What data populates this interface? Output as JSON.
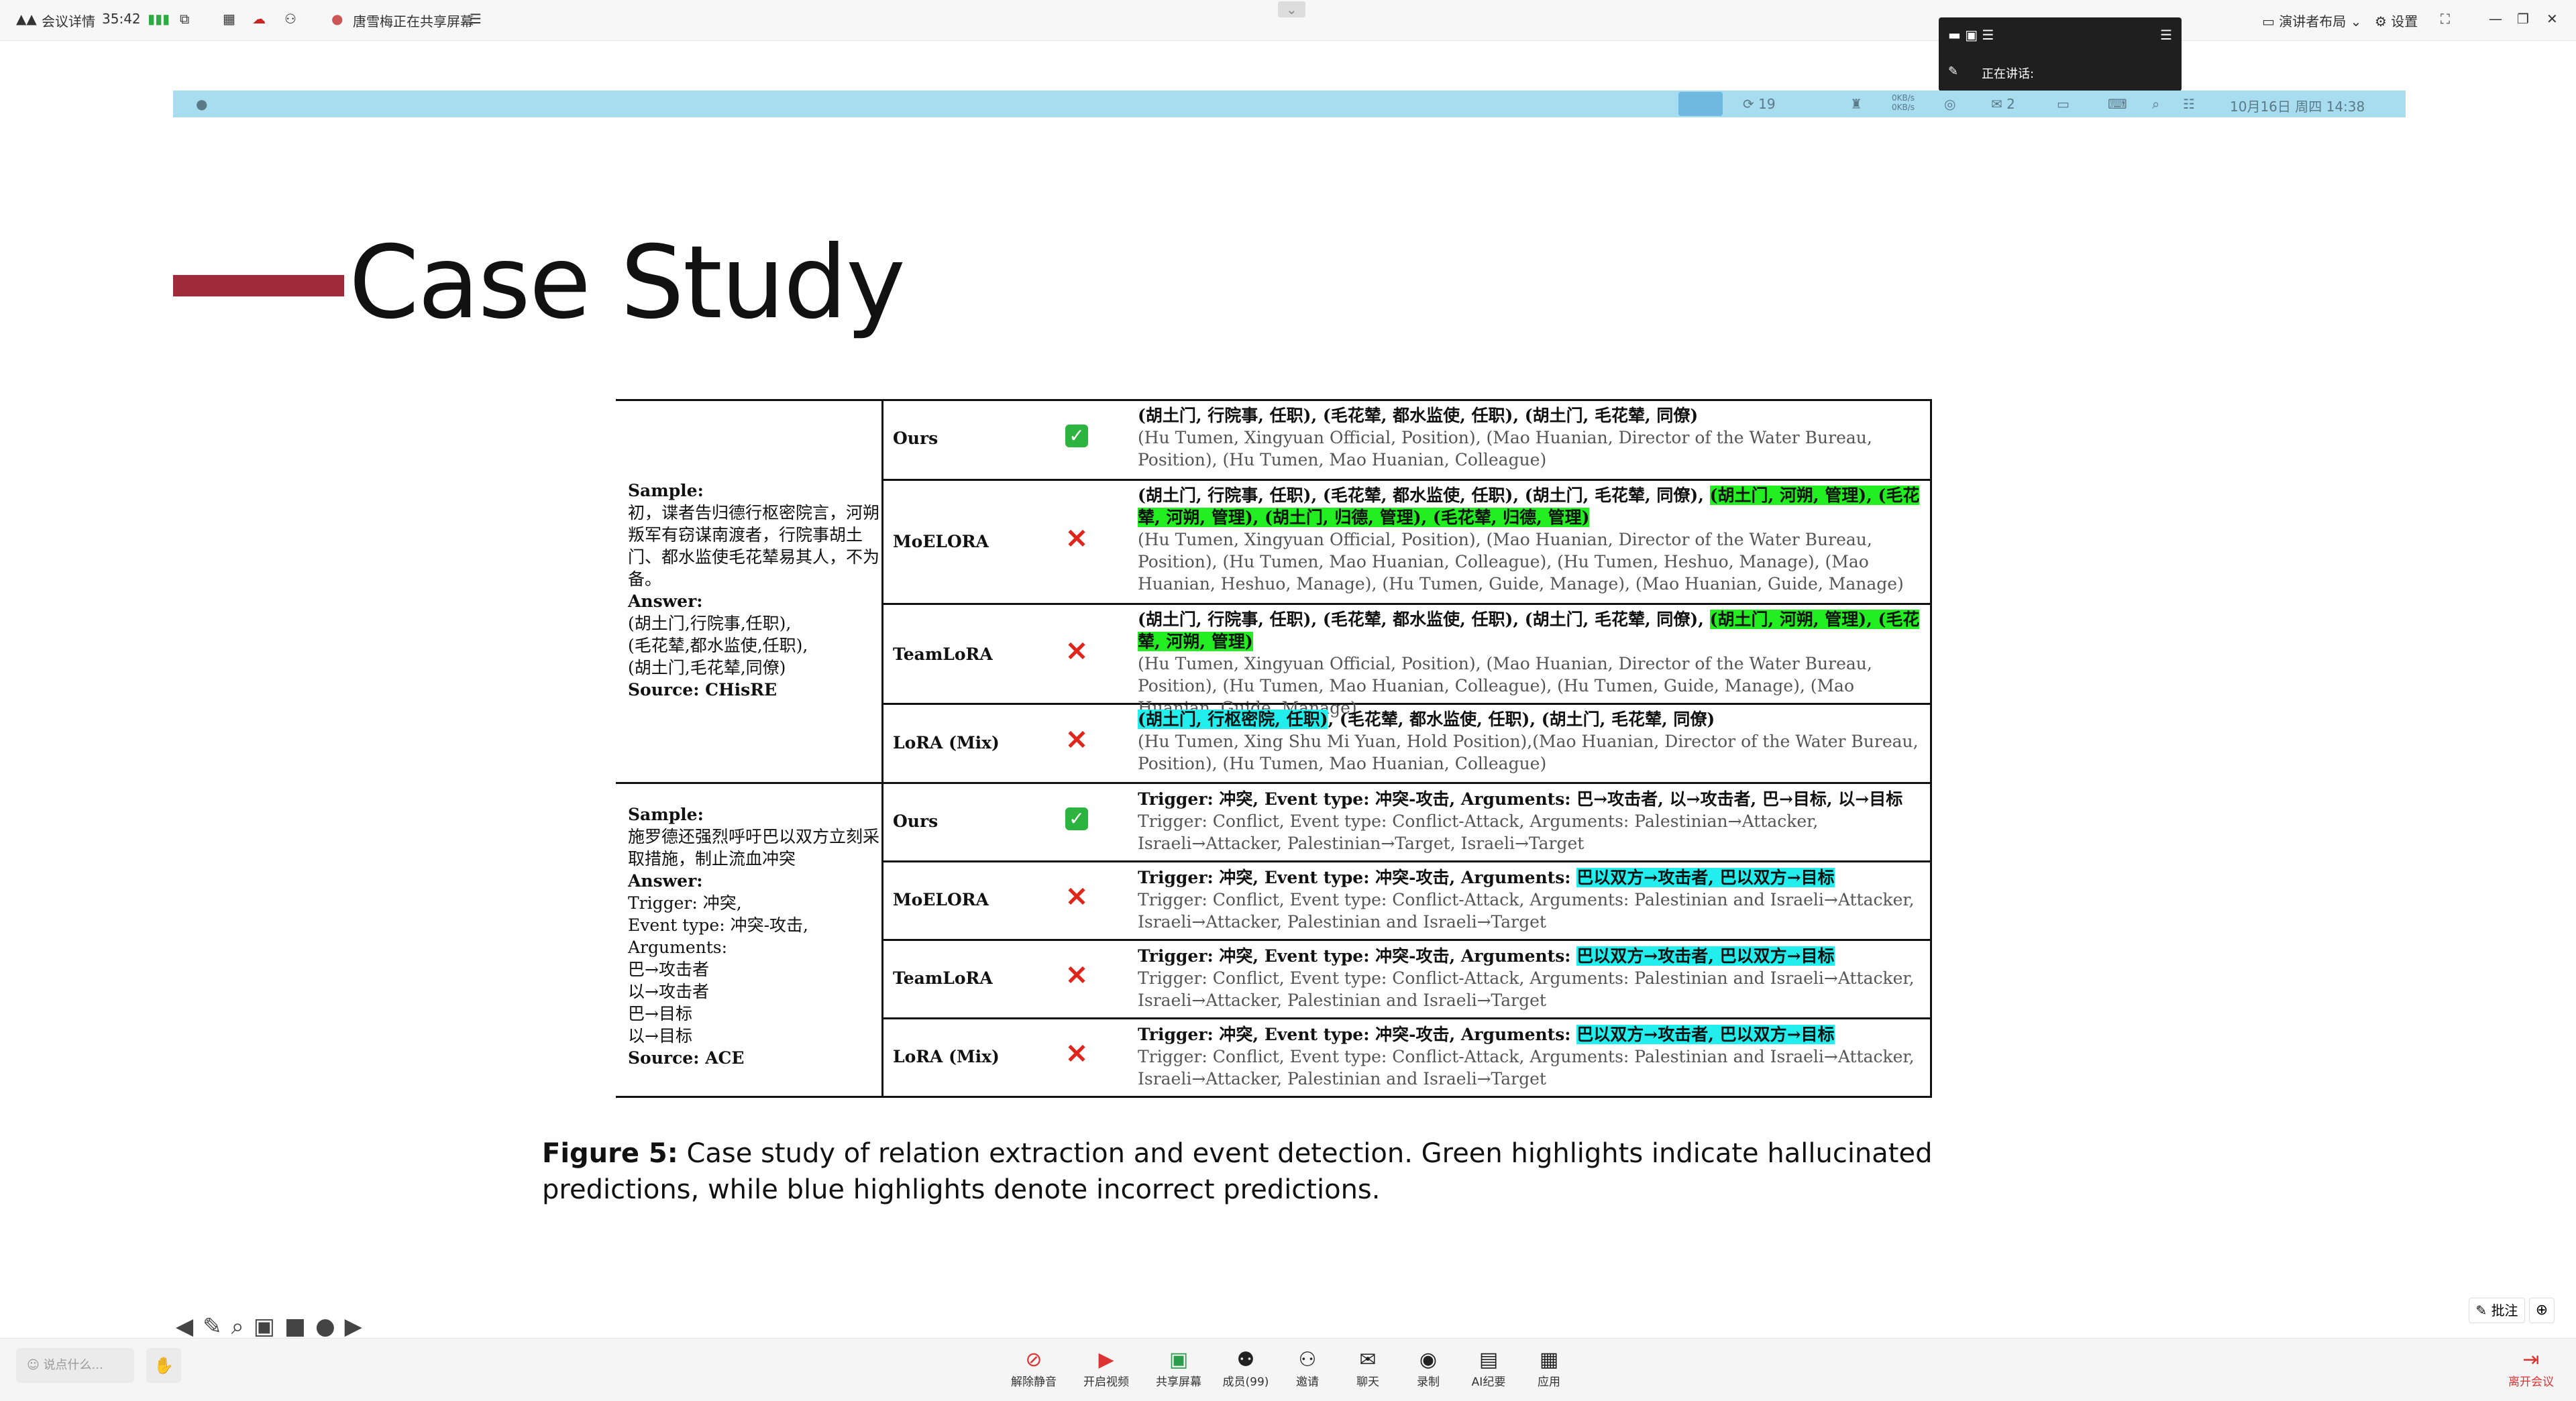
{
  "meeting": {
    "details_label": "会议详情",
    "timer": "35:42",
    "share_notice": "唐雪梅正在共享屏幕",
    "layout_label": "演讲者布局",
    "settings_label": "设置",
    "speaking_label": "正在讲话:"
  },
  "mac_menubar": {
    "count1": "19",
    "net_up": "0KB/s",
    "net_down": "0KB/s",
    "count2": "2",
    "datetime": "10月16日 周四 14:38"
  },
  "slide": {
    "title": "Case Study",
    "caption_label": "Figure 5:",
    "caption_text": " Case study of relation extraction and event detection. Green highlights indicate hallucinated predictions, while blue highlights denote incorrect predictions."
  },
  "table": {
    "group1": {
      "sample_label": "Sample:",
      "sample_text": "初，谍者告归德行枢密院言，河朔叛军有窃谋南渡者，行院事胡土门、都水监使毛花辇易其人，不为备。",
      "answer_label": "Answer:",
      "answer_lines": [
        "(胡土门,行院事,任职),",
        "(毛花辇,都水监使,任职),",
        "(胡土门,毛花辇,同僚)"
      ],
      "source": "Source: CHisRE",
      "rows": [
        {
          "method": "Ours",
          "status": "correct",
          "zh": "(胡土门, 行院事, 任职), (毛花辇, 都水监使, 任职), (胡土门, 毛花辇, 同僚)",
          "zh_hl": "",
          "en": "(Hu Tumen, Xingyuan Official, Position), (Mao Huanian, Director of the Water Bureau, Position), (Hu Tumen, Mao Huanian, Colleague)"
        },
        {
          "method": "MoELORA",
          "status": "wrong",
          "zh": "(胡土门, 行院事, 任职), (毛花辇, 都水监使, 任职), (胡土门, 毛花辇, 同僚), ",
          "zh_hl": "(胡土门, 河朔, 管理), (毛花辇, 河朔, 管理), (胡土门, 归德, 管理), (毛花辇, 归德, 管理)",
          "en": "(Hu Tumen, Xingyuan Official, Position), (Mao Huanian, Director of the Water Bureau, Position), (Hu Tumen, Mao Huanian, Colleague), (Hu Tumen, Heshuo, Manage), (Mao Huanian, Heshuo, Manage), (Hu Tumen, Guide, Manage), (Mao Huanian, Guide, Manage)"
        },
        {
          "method": "TeamLoRA",
          "status": "wrong",
          "zh": "(胡土门, 行院事, 任职), (毛花辇, 都水监使, 任职), (胡土门, 毛花辇, 同僚), ",
          "zh_hl": "(胡土门, 河朔, 管理), (毛花辇, 河朔, 管理)",
          "en": "(Hu Tumen, Xingyuan Official, Position), (Mao Huanian, Director of the Water Bureau, Position), (Hu Tumen, Mao Huanian, Colleague), (Hu Tumen, Guide, Manage), (Mao Huanian, Guide, Manage)"
        },
        {
          "method": "LoRA (Mix)",
          "status": "wrong",
          "zh_hl_prefix": "(胡土门, 行枢密院, 任职)",
          "zh": ", (毛花辇, 都水监使, 任职), (胡土门, 毛花辇, 同僚)",
          "en": "(Hu Tumen, Xing Shu Mi Yuan, Hold Position),(Mao Huanian, Director of the Water Bureau, Position), (Hu Tumen, Mao Huanian, Colleague)"
        }
      ]
    },
    "group2": {
      "sample_label": "Sample:",
      "sample_text": "施罗德还强烈呼吁巴以双方立刻采取措施，制止流血冲突",
      "answer_label": "Answer:",
      "answer_lines": [
        "Trigger: 冲突,",
        "Event type: 冲突-攻击,",
        "Arguments:",
        "巴→攻击者",
        "以→攻击者",
        "巴→目标",
        "以→目标"
      ],
      "source": "Source: ACE",
      "rows": [
        {
          "method": "Ours",
          "status": "correct",
          "zh": "Trigger: 冲突, Event type: 冲突-攻击, Arguments: 巴→攻击者, 以→攻击者, 巴→目标, 以→目标",
          "zh_hl": "",
          "en": "Trigger: Conflict, Event type: Conflict-Attack, Arguments: Palestinian→Attacker, Israeli→Attacker, Palestinian→Target, Israeli→Target"
        },
        {
          "method": "MoELORA",
          "status": "wrong",
          "zh": "Trigger: 冲突, Event type: 冲突-攻击, Arguments: ",
          "zh_hl": "巴以双方→攻击者, 巴以双方→目标",
          "en": "Trigger: Conflict, Event type: Conflict-Attack, Arguments: Palestinian and Israeli→Attacker, Israeli→Attacker, Palestinian and Israeli→Target"
        },
        {
          "method": "TeamLoRA",
          "status": "wrong",
          "zh": "Trigger: 冲突, Event type: 冲突-攻击, Arguments: ",
          "zh_hl": "巴以双方→攻击者, 巴以双方→目标",
          "en": "Trigger: Conflict, Event type: Conflict-Attack, Arguments: Palestinian and Israeli→Attacker, Israeli→Attacker, Palestinian and Israeli→Target"
        },
        {
          "method": "LoRA (Mix)",
          "status": "wrong",
          "zh": "Trigger: 冲突, Event type: 冲突-攻击, Arguments: ",
          "zh_hl": "巴以双方→攻击者, 巴以双方→目标",
          "en": "Trigger: Conflict, Event type: Conflict-Attack, Arguments: Palestinian and Israeli→Attacker, Israeli→Attacker, Palestinian and Israeli→Target"
        }
      ]
    }
  },
  "annotate_label": "批注",
  "input_placeholder": "说点什么...",
  "toolbar": {
    "items": [
      "解除静音",
      "开启视频",
      "共享屏幕",
      "成员(99)",
      "邀请",
      "聊天",
      "录制",
      "AI纪要",
      "应用"
    ],
    "leave": "离开会议"
  },
  "colors": {
    "accent_red": "#9e2a3a",
    "mac_bar": "#a8dcef",
    "green_hl": "#22ee22",
    "cyan_hl": "#22eeee"
  }
}
